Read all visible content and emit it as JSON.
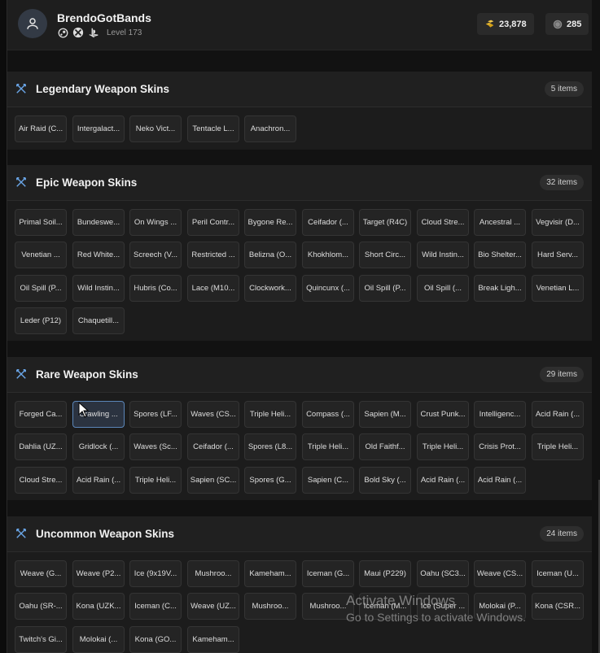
{
  "profile": {
    "username": "BrendoGotBands",
    "level": "Level 173",
    "platforms": [
      "steam-icon",
      "xbox-icon",
      "playstation-icon"
    ]
  },
  "currencies": {
    "gold": "23,878",
    "silver": "285"
  },
  "sections": [
    {
      "title": "Legendary Weapon Skins",
      "count": "5 items",
      "items": [
        "Air Raid (C...",
        "Intergalact...",
        "Neko Vict...",
        "Tentacle L...",
        "Anachron..."
      ]
    },
    {
      "title": "Epic Weapon Skins",
      "count": "32 items",
      "items": [
        "Primal Soil...",
        "Bundeswe...",
        "On Wings ...",
        "Peril Contr...",
        "Bygone Re...",
        "Ceifador (...",
        "Target (R4C)",
        "Cloud Stre...",
        "Ancestral ...",
        "Vegvisir (D...",
        "Venetian ...",
        "Red White...",
        "Screech (V...",
        "Restricted ...",
        "Belizna (O...",
        "Khokhlom...",
        "Short Circ...",
        "Wild Instin...",
        "Bio Shelter...",
        "Hard Serv...",
        "Oil Spill (P...",
        "Wild Instin...",
        "Hubris (Co...",
        "Lace (M10...",
        "Clockwork...",
        "Quincunx (...",
        "Oil Spill (P...",
        "Oil Spill (...",
        "Break Ligh...",
        "Venetian L...",
        "Leder (P12)",
        "Chaquetill..."
      ]
    },
    {
      "title": "Rare Weapon Skins",
      "count": "29 items",
      "items": [
        "Forged Ca...",
        "Crawling ...",
        "Spores (LF...",
        "Waves (CS...",
        "Triple Heli...",
        "Compass (...",
        "Sapien (M...",
        "Crust Punk...",
        "Intelligenc...",
        "Acid Rain (...",
        "Dahlia (UZ...",
        "Gridlock (...",
        "Waves (Sc...",
        "Ceifador (...",
        "Spores (L8...",
        "Triple Heli...",
        "Old Faithf...",
        "Triple Heli...",
        "Crisis Prot...",
        "Triple Heli...",
        "Cloud Stre...",
        "Acid Rain (...",
        "Triple Heli...",
        "Sapien (SC...",
        "Spores (G...",
        "Sapien (C...",
        "Bold Sky (...",
        "Acid Rain (...",
        "Acid Rain (..."
      ]
    },
    {
      "title": "Uncommon Weapon Skins",
      "count": "24 items",
      "items": [
        "Weave (G...",
        "Weave (P2...",
        "Ice (9x19V...",
        "Mushroo...",
        "Kameham...",
        "Iceman (G...",
        "Maui (P229)",
        "Oahu (SC3...",
        "Weave (CS...",
        "Iceman (U...",
        "Oahu (SR-...",
        "Kona (UZK...",
        "Iceman (C...",
        "Weave (UZ...",
        "Mushroo...",
        "Mushroo...",
        "Iceman (M...",
        "Ice (Super ...",
        "Molokai (P...",
        "Kona (CSR...",
        "Twitch's Gi...",
        "Molokai (...",
        "Kona (GO...",
        "Kameham..."
      ]
    }
  ],
  "watermark": {
    "line1": "Activate Windows",
    "line2": "Go to Settings to activate Windows."
  }
}
